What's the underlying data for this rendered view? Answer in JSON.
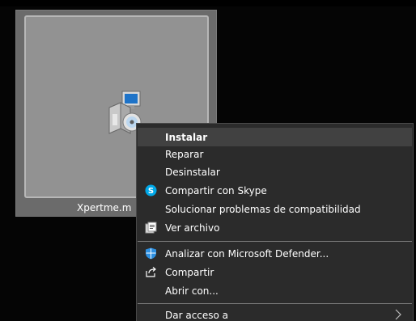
{
  "file": {
    "name": "Xpertme.m",
    "icon": "msi-installer-icon"
  },
  "context_menu": {
    "items": [
      {
        "label": "Instalar",
        "icon": ""
      },
      {
        "label": "Reparar",
        "icon": ""
      },
      {
        "label": "Desinstalar",
        "icon": ""
      },
      {
        "label": "Compartir con Skype",
        "icon": "skype-icon"
      },
      {
        "label": "Solucionar problemas de compatibilidad",
        "icon": ""
      },
      {
        "label": "Ver archivo",
        "icon": "archive-icon"
      },
      {
        "label": "Analizar con Microsoft Defender...",
        "icon": "defender-shield-icon"
      },
      {
        "label": "Compartir",
        "icon": "share-icon"
      },
      {
        "label": "Abrir con...",
        "icon": ""
      },
      {
        "label": "Dar acceso a",
        "icon": "chevron-right-icon"
      }
    ]
  },
  "colors": {
    "menu_background": "#2b2b2b",
    "menu_highlight": "#414141",
    "tile_background": "#929292",
    "skype_blue": "#00a8e8",
    "defender_blue": "#2d8fe0"
  }
}
